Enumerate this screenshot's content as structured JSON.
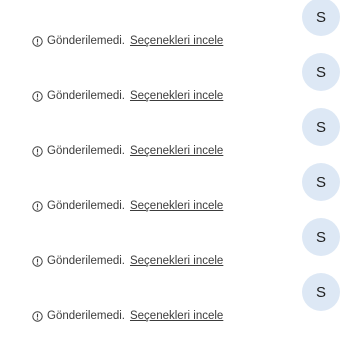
{
  "messages": [
    {
      "text": "S",
      "status": "Gönderilemedi.",
      "action": "Seçenekleri incele"
    },
    {
      "text": "S",
      "status": "Gönderilemedi.",
      "action": "Seçenekleri incele"
    },
    {
      "text": "S",
      "status": "Gönderilemedi.",
      "action": "Seçenekleri incele"
    },
    {
      "text": "S",
      "status": "Gönderilemedi.",
      "action": "Seçenekleri incele"
    },
    {
      "text": "S",
      "status": "Gönderilemedi.",
      "action": "Seçenekleri incele"
    },
    {
      "text": "S",
      "status": "Gönderilemedi.",
      "action": "Seçenekleri incele"
    }
  ],
  "colors": {
    "bubble": "#dde8f5",
    "text": "#3c3c3c"
  },
  "icons": {
    "status": "error-circle-icon"
  }
}
